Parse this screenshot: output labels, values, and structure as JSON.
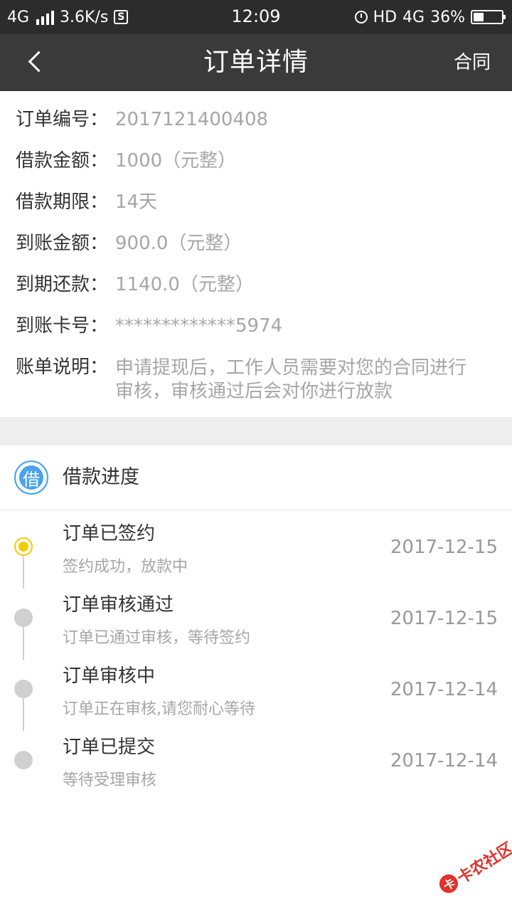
{
  "status_bar": {
    "network": "4G",
    "speed": "3.6K/s",
    "s_icon": "S",
    "time": "12:09",
    "hd": "HD",
    "network2": "4G",
    "battery_percent": "36%",
    "battery_level": 0.36
  },
  "header": {
    "back_icon": "chevron-left",
    "title": "订单详情",
    "contract_label": "合同"
  },
  "order_info": {
    "rows": [
      {
        "label": "订单编号：",
        "value": "2017121400408"
      },
      {
        "label": "借款金额：",
        "value": "1000（元整）"
      },
      {
        "label": "借款期限：",
        "value": "14天"
      },
      {
        "label": "到账金额：",
        "value": "900.0（元整）"
      },
      {
        "label": "到期还款：",
        "value": "1140.0（元整）"
      },
      {
        "label": "到账卡号：",
        "value": "*************5974"
      },
      {
        "label": "账单说明：",
        "value_line1": "申请提现后，工作人员需要对您的合同进行",
        "value_line2": "审核，审核通过后会对你进行放款"
      }
    ]
  },
  "progress": {
    "badge_text": "借",
    "title": "借款进度",
    "steps": [
      {
        "title": "订单已签约",
        "subtitle": "签约成功，放款中",
        "date": "2017-12-15",
        "active": true
      },
      {
        "title": "订单审核通过",
        "subtitle": "订单已通过审核，等待签约",
        "date": "2017-12-15",
        "active": false
      },
      {
        "title": "订单审核中",
        "subtitle": "订单正在审核,请您耐心等待",
        "date": "2017-12-14",
        "active": false
      },
      {
        "title": "订单已提交",
        "subtitle": "等待受理审核",
        "date": "2017-12-14",
        "active": false
      }
    ]
  },
  "watermark": {
    "logo_text": "卡",
    "text": "卡农社区"
  },
  "colors": {
    "header_bg": "#3a3a3a",
    "status_bg": "#2c2c2c",
    "active_dot": "#f5cc00",
    "badge": "#4aa3ea",
    "watermark": "#e0322b"
  }
}
